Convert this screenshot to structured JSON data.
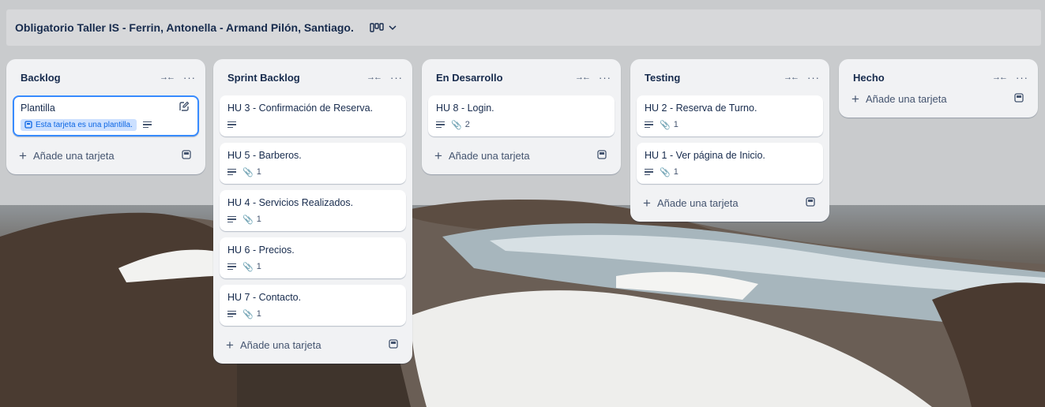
{
  "board": {
    "title": "Obligatorio Taller IS - Ferrin, Antonella - Armand Pilón, Santiago.",
    "view_icon": "board-view-icon",
    "dropdown_icon": "chevron-down-icon"
  },
  "common": {
    "add_card_label": "Añade una tarjeta",
    "collapse_icon": "collapse-arrows-icon",
    "more_icon": "more-icon"
  },
  "lists": [
    {
      "title": "Backlog",
      "cards": [
        {
          "title": "Plantilla",
          "template_badge": "Esta tarjeta es una plantilla.",
          "has_description": true
        }
      ]
    },
    {
      "title": "Sprint Backlog",
      "cards": [
        {
          "title": "HU 3 - Confirmación de Reserva.",
          "has_description": true
        },
        {
          "title": "HU 5 - Barberos.",
          "has_description": true,
          "attachments": "1"
        },
        {
          "title": "HU 4 - Servicios Realizados.",
          "has_description": true,
          "attachments": "1"
        },
        {
          "title": "HU 6 - Precios.",
          "has_description": true,
          "attachments": "1"
        },
        {
          "title": "HU 7 - Contacto.",
          "has_description": true,
          "attachments": "1"
        }
      ]
    },
    {
      "title": "En Desarrollo",
      "cards": [
        {
          "title": "HU 8 - Login.",
          "has_description": true,
          "attachments": "2"
        }
      ]
    },
    {
      "title": "Testing",
      "cards": [
        {
          "title": "HU 2 - Reserva de Turno.",
          "has_description": true,
          "attachments": "1"
        },
        {
          "title": "HU 1 - Ver página de Inicio.",
          "has_description": true,
          "attachments": "1"
        }
      ]
    },
    {
      "title": "Hecho",
      "cards": []
    }
  ],
  "colors": {
    "list_bg": "#f1f2f4",
    "card_bg": "#ffffff",
    "accent": "#388bff",
    "template_badge_bg": "#cce0ff",
    "text": "#172b4d"
  }
}
